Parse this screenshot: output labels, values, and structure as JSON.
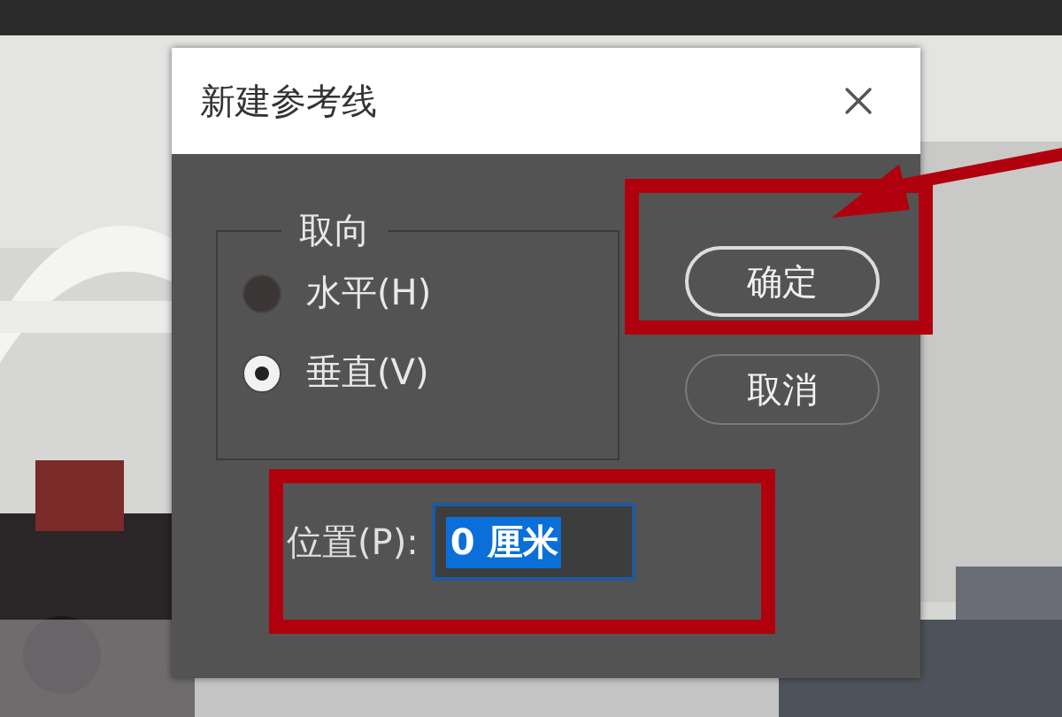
{
  "window": {
    "title": "新建参考线"
  },
  "orientation": {
    "legend": "取向",
    "options": [
      {
        "label": "水平(H)",
        "selected": false
      },
      {
        "label": "垂直(V)",
        "selected": true
      }
    ]
  },
  "buttons": [
    {
      "label": "确定",
      "default": true
    },
    {
      "label": "取消",
      "default": false
    }
  ],
  "position": {
    "label": "位置(P):",
    "value": "0 厘米",
    "text_selected": true
  }
}
